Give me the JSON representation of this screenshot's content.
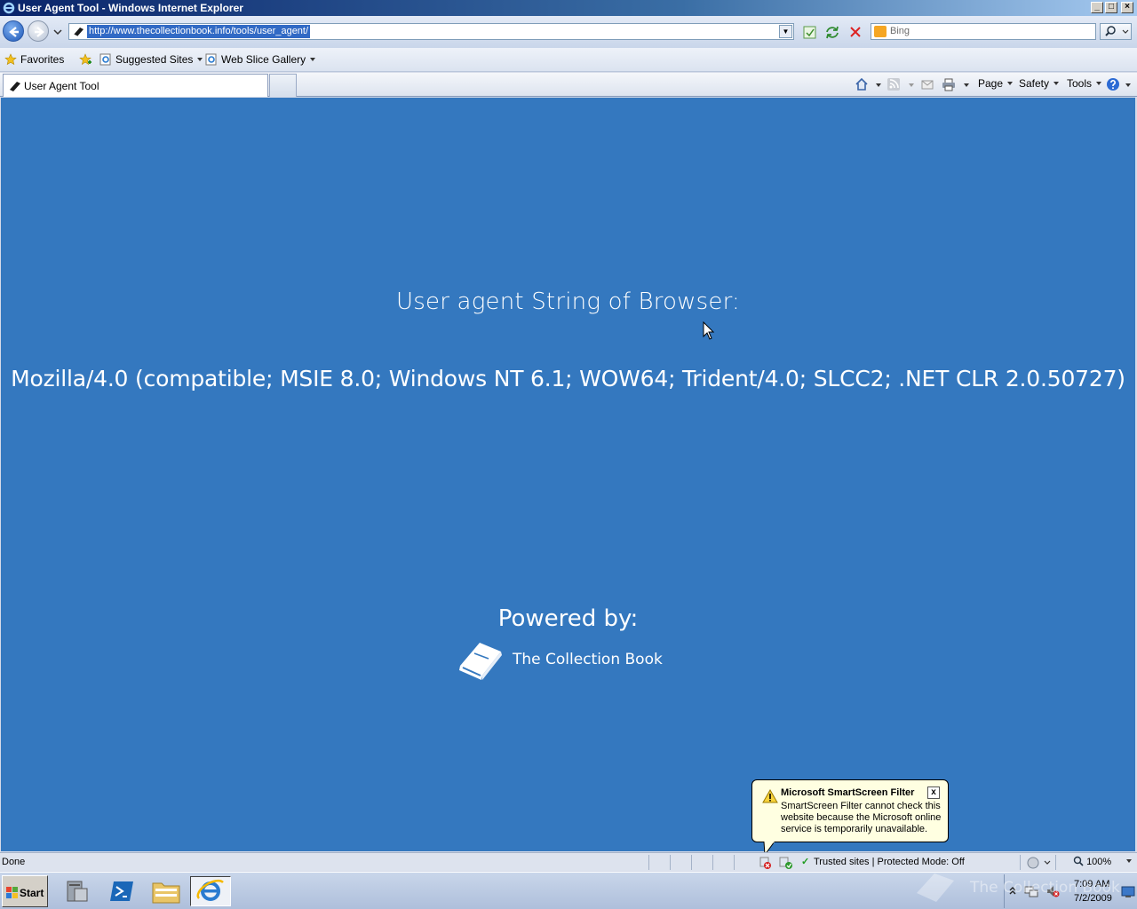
{
  "window": {
    "title": "User Agent Tool - Windows Internet Explorer",
    "minimize": "_",
    "maximize": "□",
    "close": "×"
  },
  "address_bar": {
    "url": "http://www.thecollectionbook.info/tools/user_agent/",
    "search_placeholder": "Bing"
  },
  "favorites_bar": {
    "favorites_label": "Favorites",
    "suggested_sites": "Suggested Sites",
    "web_slice_gallery": "Web Slice Gallery"
  },
  "tabs": [
    {
      "label": "User Agent Tool"
    }
  ],
  "command_bar": {
    "page": "Page",
    "safety": "Safety",
    "tools": "Tools"
  },
  "content": {
    "heading": "User agent String of Browser:",
    "user_agent": "Mozilla/4.0 (compatible; MSIE 8.0; Windows NT 6.1; WOW64; Trident/4.0; SLCC2; .NET CLR 2.0.50727)",
    "powered_by": "Powered by:",
    "brand": "The Collection Book",
    "background_color": "#3478bf"
  },
  "smartscreen": {
    "title": "Microsoft SmartScreen Filter",
    "body": "SmartScreen Filter cannot check this website because the Microsoft online service is temporarily unavailable.",
    "close": "x"
  },
  "status_bar": {
    "status": "Done",
    "zone": "Trusted sites | Protected Mode: Off",
    "zoom": "100%"
  },
  "taskbar": {
    "start": "Start",
    "time": "7:09 AM",
    "date": "7/2/2009",
    "watermark": "The Collection Book"
  }
}
